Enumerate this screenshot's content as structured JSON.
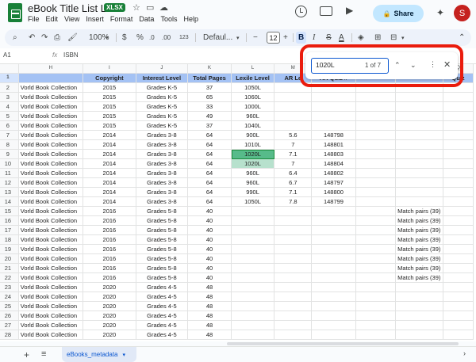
{
  "app": {
    "doc_title": "eBook Title List LIVE",
    "badge": "XLSX",
    "menu": [
      "File",
      "Edit",
      "View",
      "Insert",
      "Format",
      "Data",
      "Tools",
      "Help"
    ],
    "share_label": "Share",
    "avatar_initial": "S",
    "accent": "#188038"
  },
  "toolbar": {
    "zoom": "100%",
    "currency": "$",
    "percent": "%",
    "dec_decrease": ".0",
    "dec_increase": ".00",
    "number_format": "123",
    "font": "Defaul...",
    "font_size": "12",
    "bold": "B",
    "italic": "I",
    "strike": "S",
    "text_color": "A"
  },
  "formula_bar": {
    "cell_ref": "A1",
    "value": "ISBN"
  },
  "find": {
    "query": "1020L",
    "count": "1 of 7"
  },
  "sheet": {
    "column_letters": [
      "",
      "H",
      "I",
      "J",
      "K",
      "L",
      "M",
      "N",
      "O",
      "P",
      "Q"
    ],
    "header_row": [
      "",
      "Copyright",
      "Interest Level",
      "Total Pages",
      "Lexile Level",
      "AR Le",
      "AR Quiz #",
      "",
      "",
      "Quiz"
    ],
    "rows": [
      {
        "n": "2",
        "cells": [
          "Vorld Book Collection",
          "2015",
          "Grades K-5",
          "37",
          "1050L",
          "",
          "",
          "",
          "",
          ""
        ]
      },
      {
        "n": "3",
        "cells": [
          "Vorld Book Collection",
          "2015",
          "Grades K-5",
          "65",
          "1060L",
          "",
          "",
          "",
          "",
          ""
        ]
      },
      {
        "n": "4",
        "cells": [
          "Vorld Book Collection",
          "2015",
          "Grades K-5",
          "33",
          "1000L",
          "",
          "",
          "",
          "",
          ""
        ]
      },
      {
        "n": "5",
        "cells": [
          "Vorld Book Collection",
          "2015",
          "Grades K-5",
          "49",
          "960L",
          "",
          "",
          "",
          "",
          ""
        ]
      },
      {
        "n": "6",
        "cells": [
          "Vorld Book Collection",
          "2015",
          "Grades K-5",
          "37",
          "1040L",
          "",
          "",
          "",
          "",
          ""
        ]
      },
      {
        "n": "7",
        "cells": [
          "Vorld Book Collection",
          "2014",
          "Grades 3-8",
          "64",
          "900L",
          "5.6",
          "148798",
          "",
          "",
          ""
        ]
      },
      {
        "n": "8",
        "cells": [
          "Vorld Book Collection",
          "2014",
          "Grades 3-8",
          "64",
          "1010L",
          "7",
          "148801",
          "",
          "",
          ""
        ]
      },
      {
        "n": "9",
        "cells": [
          "Vorld Book Collection",
          "2014",
          "Grades 3-8",
          "64",
          "1020L",
          "7.1",
          "148803",
          "",
          "",
          ""
        ]
      },
      {
        "n": "10",
        "cells": [
          "Vorld Book Collection",
          "2014",
          "Grades 3-8",
          "64",
          "1020L",
          "7",
          "148804",
          "",
          "",
          ""
        ]
      },
      {
        "n": "11",
        "cells": [
          "Vorld Book Collection",
          "2014",
          "Grades 3-8",
          "64",
          "960L",
          "6.4",
          "148802",
          "",
          "",
          ""
        ]
      },
      {
        "n": "12",
        "cells": [
          "Vorld Book Collection",
          "2014",
          "Grades 3-8",
          "64",
          "960L",
          "6.7",
          "148797",
          "",
          "",
          ""
        ]
      },
      {
        "n": "13",
        "cells": [
          "Vorld Book Collection",
          "2014",
          "Grades 3-8",
          "64",
          "990L",
          "7.1",
          "148800",
          "",
          "",
          ""
        ]
      },
      {
        "n": "14",
        "cells": [
          "Vorld Book Collection",
          "2014",
          "Grades 3-8",
          "64",
          "1050L",
          "7.8",
          "148799",
          "",
          "",
          ""
        ]
      },
      {
        "n": "15",
        "cells": [
          "Vorld Book Collection",
          "2016",
          "Grades 5-8",
          "40",
          "",
          "",
          "",
          "",
          "Match pairs (39)",
          ""
        ]
      },
      {
        "n": "16",
        "cells": [
          "Vorld Book Collection",
          "2016",
          "Grades 5-8",
          "40",
          "",
          "",
          "",
          "",
          "Match pairs (39)",
          ""
        ]
      },
      {
        "n": "17",
        "cells": [
          "Vorld Book Collection",
          "2016",
          "Grades 5-8",
          "40",
          "",
          "",
          "",
          "",
          "Match pairs (39)",
          ""
        ]
      },
      {
        "n": "18",
        "cells": [
          "Vorld Book Collection",
          "2016",
          "Grades 5-8",
          "40",
          "",
          "",
          "",
          "",
          "Match pairs (39)",
          ""
        ]
      },
      {
        "n": "19",
        "cells": [
          "Vorld Book Collection",
          "2016",
          "Grades 5-8",
          "40",
          "",
          "",
          "",
          "",
          "Match pairs (39)",
          ""
        ]
      },
      {
        "n": "20",
        "cells": [
          "Vorld Book Collection",
          "2016",
          "Grades 5-8",
          "40",
          "",
          "",
          "",
          "",
          "Match pairs (39)",
          ""
        ]
      },
      {
        "n": "21",
        "cells": [
          "Vorld Book Collection",
          "2016",
          "Grades 5-8",
          "40",
          "",
          "",
          "",
          "",
          "Match pairs (39)",
          ""
        ]
      },
      {
        "n": "22",
        "cells": [
          "Vorld Book Collection",
          "2016",
          "Grades 5-8",
          "40",
          "",
          "",
          "",
          "",
          "Match pairs (39)",
          ""
        ]
      },
      {
        "n": "23",
        "cells": [
          "Vorld Book Collection",
          "2020",
          "Grades 4-5",
          "48",
          "",
          "",
          "",
          "",
          "",
          ""
        ]
      },
      {
        "n": "24",
        "cells": [
          "Vorld Book Collection",
          "2020",
          "Grades 4-5",
          "48",
          "",
          "",
          "",
          "",
          "",
          ""
        ]
      },
      {
        "n": "25",
        "cells": [
          "Vorld Book Collection",
          "2020",
          "Grades 4-5",
          "48",
          "",
          "",
          "",
          "",
          "",
          ""
        ]
      },
      {
        "n": "26",
        "cells": [
          "Vorld Book Collection",
          "2020",
          "Grades 4-5",
          "48",
          "",
          "",
          "",
          "",
          "",
          ""
        ]
      },
      {
        "n": "27",
        "cells": [
          "Vorld Book Collection",
          "2020",
          "Grades 4-5",
          "48",
          "",
          "",
          "",
          "",
          "",
          ""
        ]
      },
      {
        "n": "28",
        "cells": [
          "Vorld Book Collection",
          "2020",
          "Grades 4-5",
          "48",
          "",
          "",
          "",
          "",
          "",
          ""
        ]
      }
    ],
    "highlight_rows": {
      "active": "9",
      "match": "10"
    }
  },
  "bottom": {
    "sheet_tab": "eBooks_metadata"
  }
}
